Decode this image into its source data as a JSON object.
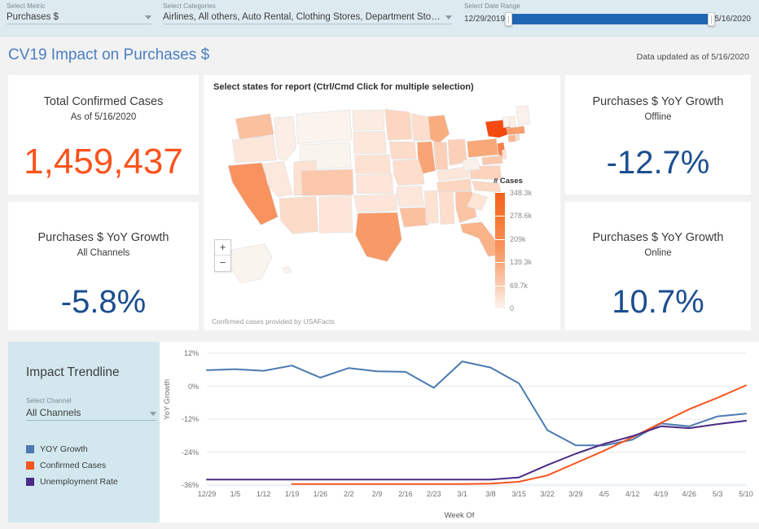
{
  "topbar": {
    "metric": {
      "label": "Select Metric",
      "value": "Purchases $",
      "icon": "chevron-down-icon"
    },
    "categories": {
      "label": "Select Categories",
      "value": "Airlines, All others, Auto Rental, Clothing Stores, Department Stores, Disc…",
      "icon": "chevron-down-icon"
    },
    "date_range": {
      "label": "Select Date Range",
      "start": "12/29/2019",
      "end": "5/16/2020",
      "track_color": "#1f66b5"
    }
  },
  "header": {
    "title": "CV19 Impact on Purchases $",
    "updated": "Data updated as of 5/16/2020",
    "title_color": "#4a7fc1"
  },
  "cards": {
    "total_cases": {
      "title": "Total Confirmed Cases",
      "subtitle": "As of 5/16/2020",
      "value": "1,459,437",
      "value_color": "#f9541e"
    },
    "yoy_all": {
      "title": "Purchases $ YoY Growth",
      "subtitle": "All Channels",
      "value": "-5.8%",
      "value_color": "#1c4e8f"
    },
    "yoy_offline": {
      "title": "Purchases $ YoY Growth",
      "subtitle": "Offline",
      "value": "-12.7%",
      "value_color": "#1c4e8f"
    },
    "yoy_online": {
      "title": "Purchases $ YoY Growth",
      "subtitle": "Online",
      "value": "10.7%",
      "value_color": "#1c4e8f"
    }
  },
  "map": {
    "instruction": "Select states for report (Ctrl/Cmd Click for multiple selection)",
    "credit": "Confirmed cases provided by USAFacts",
    "zoom_in": "+",
    "zoom_out": "−",
    "legend": {
      "title": "# Cases",
      "ticks": [
        "348.3k",
        "278.6k",
        "209k",
        "139.3k",
        "69.7k",
        "0"
      ]
    },
    "states": [
      {
        "code": "WA",
        "v": 0.38
      },
      {
        "code": "OR",
        "v": 0.13
      },
      {
        "code": "CA",
        "v": 0.62
      },
      {
        "code": "NV",
        "v": 0.12
      },
      {
        "code": "ID",
        "v": 0.07
      },
      {
        "code": "MT",
        "v": 0.03
      },
      {
        "code": "WY",
        "v": 0.02
      },
      {
        "code": "UT",
        "v": 0.18
      },
      {
        "code": "AZ",
        "v": 0.22
      },
      {
        "code": "NM",
        "v": 0.14
      },
      {
        "code": "CO",
        "v": 0.34
      },
      {
        "code": "ND",
        "v": 0.1
      },
      {
        "code": "SD",
        "v": 0.13
      },
      {
        "code": "NE",
        "v": 0.17
      },
      {
        "code": "KS",
        "v": 0.15
      },
      {
        "code": "OK",
        "v": 0.14
      },
      {
        "code": "TX",
        "v": 0.58
      },
      {
        "code": "MN",
        "v": 0.26
      },
      {
        "code": "IA",
        "v": 0.22
      },
      {
        "code": "MO",
        "v": 0.21
      },
      {
        "code": "AR",
        "v": 0.13
      },
      {
        "code": "LA",
        "v": 0.38
      },
      {
        "code": "WI",
        "v": 0.2
      },
      {
        "code": "IL",
        "v": 0.52
      },
      {
        "code": "MI",
        "v": 0.48
      },
      {
        "code": "IN",
        "v": 0.3
      },
      {
        "code": "OH",
        "v": 0.3
      },
      {
        "code": "KY",
        "v": 0.14
      },
      {
        "code": "TN",
        "v": 0.26
      },
      {
        "code": "MS",
        "v": 0.18
      },
      {
        "code": "AL",
        "v": 0.21
      },
      {
        "code": "GA",
        "v": 0.36
      },
      {
        "code": "FL",
        "v": 0.45
      },
      {
        "code": "SC",
        "v": 0.16
      },
      {
        "code": "NC",
        "v": 0.25
      },
      {
        "code": "VA",
        "v": 0.28
      },
      {
        "code": "WV",
        "v": 0.04
      },
      {
        "code": "PA",
        "v": 0.5
      },
      {
        "code": "NY",
        "v": 1.0
      },
      {
        "code": "NJ",
        "v": 0.72
      },
      {
        "code": "MD",
        "v": 0.34
      },
      {
        "code": "DE",
        "v": 0.18
      },
      {
        "code": "CT",
        "v": 0.42
      },
      {
        "code": "RI",
        "v": 0.25
      },
      {
        "code": "MA",
        "v": 0.56
      },
      {
        "code": "VT",
        "v": 0.03
      },
      {
        "code": "NH",
        "v": 0.08
      },
      {
        "code": "ME",
        "v": 0.05
      },
      {
        "code": "AK",
        "v": 0.02
      },
      {
        "code": "HI",
        "v": 0.02
      }
    ]
  },
  "trendline": {
    "heading": "Impact Trendline",
    "channel": {
      "label": "Select Channel",
      "value": "All Channels",
      "icon": "chevron-down-icon"
    },
    "legend": [
      {
        "label": "YOY Growth",
        "color": "#4a7ab0"
      },
      {
        "label": "Confirmed Cases",
        "color": "#f9541e"
      },
      {
        "label": "Unemployment Rate",
        "color": "#4b2a86"
      }
    ]
  },
  "chart_data": {
    "type": "line",
    "title": "Impact Trendline",
    "xlabel": "Week Of",
    "ylabel": "YoY Growth",
    "ylim": [
      -36,
      12
    ],
    "yticks": [
      12,
      0,
      -12,
      -24,
      -36
    ],
    "ytick_labels": [
      "12%",
      "0%",
      "-12%",
      "-24%",
      "-36%"
    ],
    "grid": true,
    "legend_position": "left",
    "categories": [
      "12/29",
      "1/5",
      "1/12",
      "1/19",
      "1/26",
      "2/2",
      "2/9",
      "2/16",
      "2/23",
      "3/1",
      "3/8",
      "3/15",
      "3/22",
      "3/29",
      "4/5",
      "4/12",
      "4/19",
      "4/26",
      "5/3",
      "5/10"
    ],
    "series": [
      {
        "name": "YOY Growth",
        "color": "#4a7ab0",
        "values": [
          5.8,
          6.2,
          5.6,
          7.5,
          3.1,
          6.6,
          5.4,
          5.2,
          -0.6,
          9.0,
          6.8,
          1.0,
          -16.0,
          -21.5,
          -21.6,
          -19.5,
          -13.6,
          -14.6,
          -11.0,
          -10.0
        ]
      },
      {
        "name": "Confirmed Cases",
        "color": "#f9541e",
        "values": [
          null,
          null,
          null,
          -35.6,
          -35.6,
          -35.6,
          -35.6,
          -35.6,
          -35.6,
          -35.6,
          -35.5,
          -34.8,
          -32.5,
          -28.0,
          -23.5,
          -18.6,
          -13.4,
          -8.4,
          -4.2,
          0.3
        ]
      },
      {
        "name": "Unemployment Rate",
        "color": "#4b2a86",
        "values": [
          -34.0,
          -34.0,
          -34.0,
          -34.0,
          -34.0,
          -34.0,
          -34.0,
          -34.0,
          -34.0,
          -34.0,
          -34.0,
          -33.2,
          -28.7,
          -24.6,
          -21.0,
          -18.2,
          -14.6,
          -15.3,
          -13.8,
          -12.6
        ]
      }
    ]
  }
}
